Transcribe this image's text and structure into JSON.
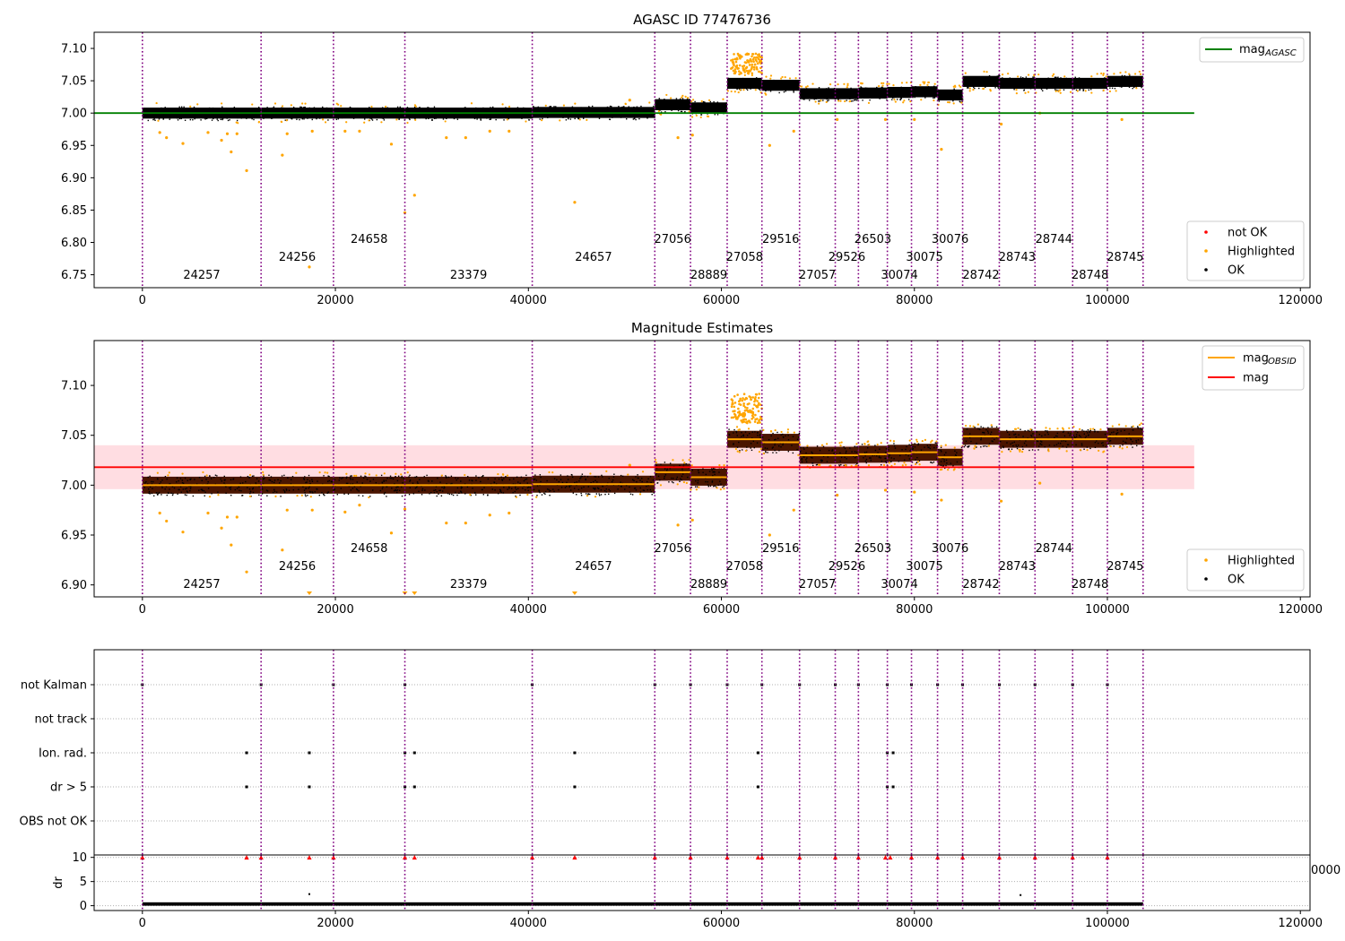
{
  "chart_data": [
    {
      "type": "scatter",
      "title": "AGASC ID 77476736",
      "xlim": [
        -5000,
        121000
      ],
      "ylim": [
        6.73,
        7.125
      ],
      "xticks": [
        0,
        20000,
        40000,
        60000,
        80000,
        100000,
        120000
      ],
      "xtick_labels": [
        "0",
        "20000",
        "40000",
        "60000",
        "80000",
        "100000",
        "120000"
      ],
      "yticks": [
        6.75,
        6.8,
        6.85,
        6.9,
        6.95,
        7.0,
        7.05,
        7.1
      ],
      "ytick_labels": [
        "6.75",
        "6.80",
        "6.85",
        "6.90",
        "6.95",
        "7.00",
        "7.05",
        "7.10"
      ],
      "reference_line": {
        "y": 7.0,
        "x": [
          -5000,
          109000
        ],
        "color": "#008000"
      },
      "legend_top": [
        {
          "label": "mag",
          "sub": "AGASC",
          "color": "#008000",
          "kind": "line"
        }
      ],
      "legend_bottom": [
        {
          "label": "not OK",
          "color": "#ff0000",
          "kind": "dot"
        },
        {
          "label": "Highlighted",
          "color": "#ffa500",
          "kind": "dot"
        },
        {
          "label": "OK",
          "color": "#000000",
          "kind": "dot"
        }
      ],
      "outliers": [
        [
          1800,
          6.97
        ],
        [
          2500,
          6.962
        ],
        [
          4200,
          6.953
        ],
        [
          6800,
          6.97
        ],
        [
          8200,
          6.958
        ],
        [
          8800,
          6.968
        ],
        [
          9200,
          6.94
        ],
        [
          9800,
          6.968
        ],
        [
          10800,
          6.911
        ],
        [
          14500,
          6.935
        ],
        [
          15000,
          6.968
        ],
        [
          17300,
          6.762
        ],
        [
          17600,
          6.972
        ],
        [
          21000,
          6.972
        ],
        [
          22500,
          6.972
        ],
        [
          25800,
          6.952
        ],
        [
          27200,
          6.846
        ],
        [
          28200,
          6.873
        ],
        [
          31500,
          6.962
        ],
        [
          33500,
          6.962
        ],
        [
          36000,
          6.972
        ],
        [
          38000,
          6.972
        ],
        [
          44800,
          6.862
        ],
        [
          50500,
          7.02
        ],
        [
          55500,
          6.962
        ],
        [
          57000,
          6.966
        ],
        [
          65000,
          6.95
        ],
        [
          67500,
          6.972
        ],
        [
          72000,
          6.99
        ],
        [
          77000,
          6.99
        ],
        [
          80000,
          6.99
        ],
        [
          82800,
          6.944
        ],
        [
          89000,
          6.983
        ],
        [
          101500,
          6.99
        ],
        [
          93000,
          7.0
        ]
      ]
    },
    {
      "type": "scatter",
      "title": "Magnitude Estimates",
      "xlim": [
        -5000,
        121000
      ],
      "ylim": [
        6.888,
        7.145
      ],
      "xticks": [
        0,
        20000,
        40000,
        60000,
        80000,
        100000,
        120000
      ],
      "xtick_labels": [
        "0",
        "20000",
        "40000",
        "60000",
        "80000",
        "100000",
        "120000"
      ],
      "yticks": [
        6.9,
        6.95,
        7.0,
        7.05,
        7.1
      ],
      "ytick_labels": [
        "6.90",
        "6.95",
        "7.00",
        "7.05",
        "7.10"
      ],
      "mean_line": {
        "y": 7.018,
        "x": [
          -5000,
          109000
        ],
        "color": "#ff0000"
      },
      "mean_band": [
        6.996,
        7.04
      ],
      "legend_top": [
        {
          "label": "mag",
          "sub": "OBSID",
          "color": "#ffa500",
          "kind": "line"
        },
        {
          "label": "mag",
          "sub": "",
          "color": "#ff0000",
          "kind": "line"
        }
      ],
      "legend_bottom": [
        {
          "label": "Highlighted",
          "color": "#ffa500",
          "kind": "dot"
        },
        {
          "label": "OK",
          "color": "#000000",
          "kind": "dot"
        }
      ],
      "outliers": [
        [
          1800,
          6.972
        ],
        [
          2500,
          6.964
        ],
        [
          4200,
          6.953
        ],
        [
          6800,
          6.972
        ],
        [
          8200,
          6.957
        ],
        [
          8800,
          6.968
        ],
        [
          9200,
          6.94
        ],
        [
          9800,
          6.968
        ],
        [
          10800,
          6.913
        ],
        [
          14500,
          6.935
        ],
        [
          15000,
          6.975
        ],
        [
          17600,
          6.975
        ],
        [
          21000,
          6.973
        ],
        [
          22500,
          6.98
        ],
        [
          25800,
          6.952
        ],
        [
          27200,
          6.976
        ],
        [
          31500,
          6.962
        ],
        [
          33500,
          6.962
        ],
        [
          36000,
          6.97
        ],
        [
          38000,
          6.972
        ],
        [
          50500,
          7.02
        ],
        [
          55500,
          6.96
        ],
        [
          57000,
          6.965
        ],
        [
          65000,
          6.95
        ],
        [
          67500,
          6.975
        ],
        [
          72000,
          6.99
        ],
        [
          77000,
          6.995
        ],
        [
          80000,
          6.993
        ],
        [
          82800,
          6.985
        ],
        [
          89000,
          6.984
        ],
        [
          93000,
          7.002
        ],
        [
          101500,
          6.991
        ]
      ],
      "below_axis_markers": [
        17300,
        27200,
        28200,
        44800
      ]
    },
    {
      "type": "scatter",
      "title": "",
      "xlim": [
        -5000,
        121000
      ],
      "categories": [
        "not Kalman",
        "not track",
        "Ion. rad.",
        "dr > 5",
        "OBS not OK"
      ],
      "flag_points": {
        "not Kalman": [
          0,
          12300,
          19800,
          27200,
          40400,
          53100,
          56800,
          60600,
          64200,
          68100,
          71800,
          74200,
          77200,
          79700,
          82400,
          85000,
          88800,
          92500,
          96400,
          100000
        ],
        "not track": [],
        "Ion. rad.": [
          10800,
          17300,
          27200,
          28200,
          44800,
          63800,
          77200,
          77800
        ],
        "dr > 5": [
          10800,
          17300,
          27200,
          28200,
          44800,
          63800,
          77200,
          77800
        ],
        "OBS not OK": []
      },
      "dr_subplot": {
        "ylabel": "dr",
        "yticks": [
          0,
          5,
          10
        ],
        "ytick_labels": [
          "0",
          "5",
          "10"
        ],
        "xticks": [
          0,
          20000,
          40000,
          60000,
          80000,
          100000,
          120000
        ],
        "xtick_labels": [
          "0",
          "20000",
          "40000",
          "60000",
          "80000",
          "100000",
          "120000"
        ],
        "ghost_tick_label": "0000",
        "clipped_markers": [
          0,
          10800,
          12300,
          17300,
          19800,
          27200,
          28200,
          40400,
          44800,
          53100,
          56800,
          60600,
          63800,
          64200,
          68100,
          71800,
          74200,
          77000,
          77500,
          79700,
          82400,
          85000,
          88800,
          92500,
          96400,
          100000
        ]
      }
    }
  ],
  "observations": [
    {
      "id": "24257",
      "start": 0,
      "end": 12300,
      "level": 7.0,
      "label_row": 2
    },
    {
      "id": "24256",
      "start": 12300,
      "end": 19800,
      "level": 7.0,
      "label_row": 1
    },
    {
      "id": "24658",
      "start": 19800,
      "end": 27200,
      "level": 7.0,
      "label_row": 0
    },
    {
      "id": "23379",
      "start": 27200,
      "end": 40400,
      "level": 7.0,
      "label_row": 2
    },
    {
      "id": "24657",
      "start": 40400,
      "end": 53100,
      "level": 7.001,
      "label_row": 1
    },
    {
      "id": "27056",
      "start": 53100,
      "end": 56800,
      "level": 7.013,
      "label_row": 0
    },
    {
      "id": "28889",
      "start": 56800,
      "end": 60600,
      "level": 7.008,
      "label_row": 2
    },
    {
      "id": "27058",
      "start": 60600,
      "end": 64200,
      "level": 7.046,
      "label_row": 1
    },
    {
      "id": "29516",
      "start": 64200,
      "end": 68100,
      "level": 7.043,
      "label_row": 0
    },
    {
      "id": "27057",
      "start": 68100,
      "end": 71800,
      "level": 7.03,
      "label_row": 2
    },
    {
      "id": "29526",
      "start": 71800,
      "end": 74200,
      "level": 7.03,
      "label_row": 1
    },
    {
      "id": "26503",
      "start": 74200,
      "end": 77200,
      "level": 7.031,
      "label_row": 0
    },
    {
      "id": "30074",
      "start": 77200,
      "end": 79700,
      "level": 7.032,
      "label_row": 2
    },
    {
      "id": "30075",
      "start": 79700,
      "end": 82400,
      "level": 7.033,
      "label_row": 1
    },
    {
      "id": "30076",
      "start": 82400,
      "end": 85000,
      "level": 7.028,
      "label_row": 0
    },
    {
      "id": "28742",
      "start": 85000,
      "end": 88800,
      "level": 7.049,
      "label_row": 2
    },
    {
      "id": "28743",
      "start": 88800,
      "end": 92500,
      "level": 7.046,
      "label_row": 1
    },
    {
      "id": "28744",
      "start": 92500,
      "end": 96400,
      "level": 7.046,
      "label_row": 0
    },
    {
      "id": "28748",
      "start": 96400,
      "end": 100000,
      "level": 7.046,
      "label_row": 2
    },
    {
      "id": "28745",
      "start": 100000,
      "end": 103700,
      "level": 7.049,
      "label_row": 1
    }
  ],
  "colors": {
    "ok": "#000000",
    "highlighted": "#ffa500",
    "not_ok": "#ff0000",
    "obs_boundary": "#800080",
    "agasc_line": "#008000",
    "mean_line": "#ff0000",
    "mean_band": "#ffdde2",
    "band_fill": "#4a1500"
  }
}
